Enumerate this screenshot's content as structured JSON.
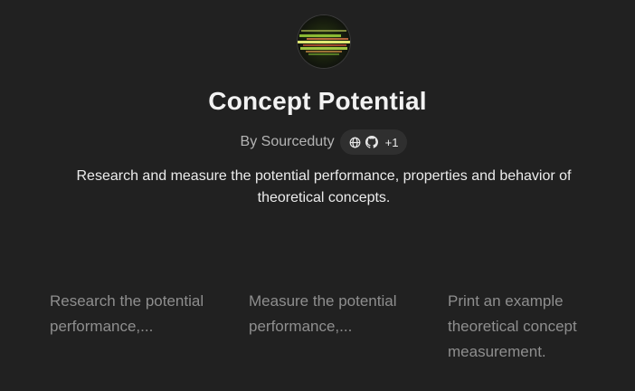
{
  "gpt": {
    "name": "Concept Potential",
    "author": "By Sourceduty",
    "links": {
      "icons": [
        "globe-icon",
        "github-icon"
      ],
      "more": "+1"
    },
    "description": "Research and measure the potential performance, properties and behavior of theoretical concepts."
  },
  "starters": [
    {
      "text": "Research the potential performance,..."
    },
    {
      "text": "Measure the potential performance,..."
    },
    {
      "text": "Print an example theoretical concept measurement."
    }
  ],
  "colors": {
    "background": "#212121",
    "pill": "#2f2f2f",
    "starter_text": "#8e8e8e"
  }
}
